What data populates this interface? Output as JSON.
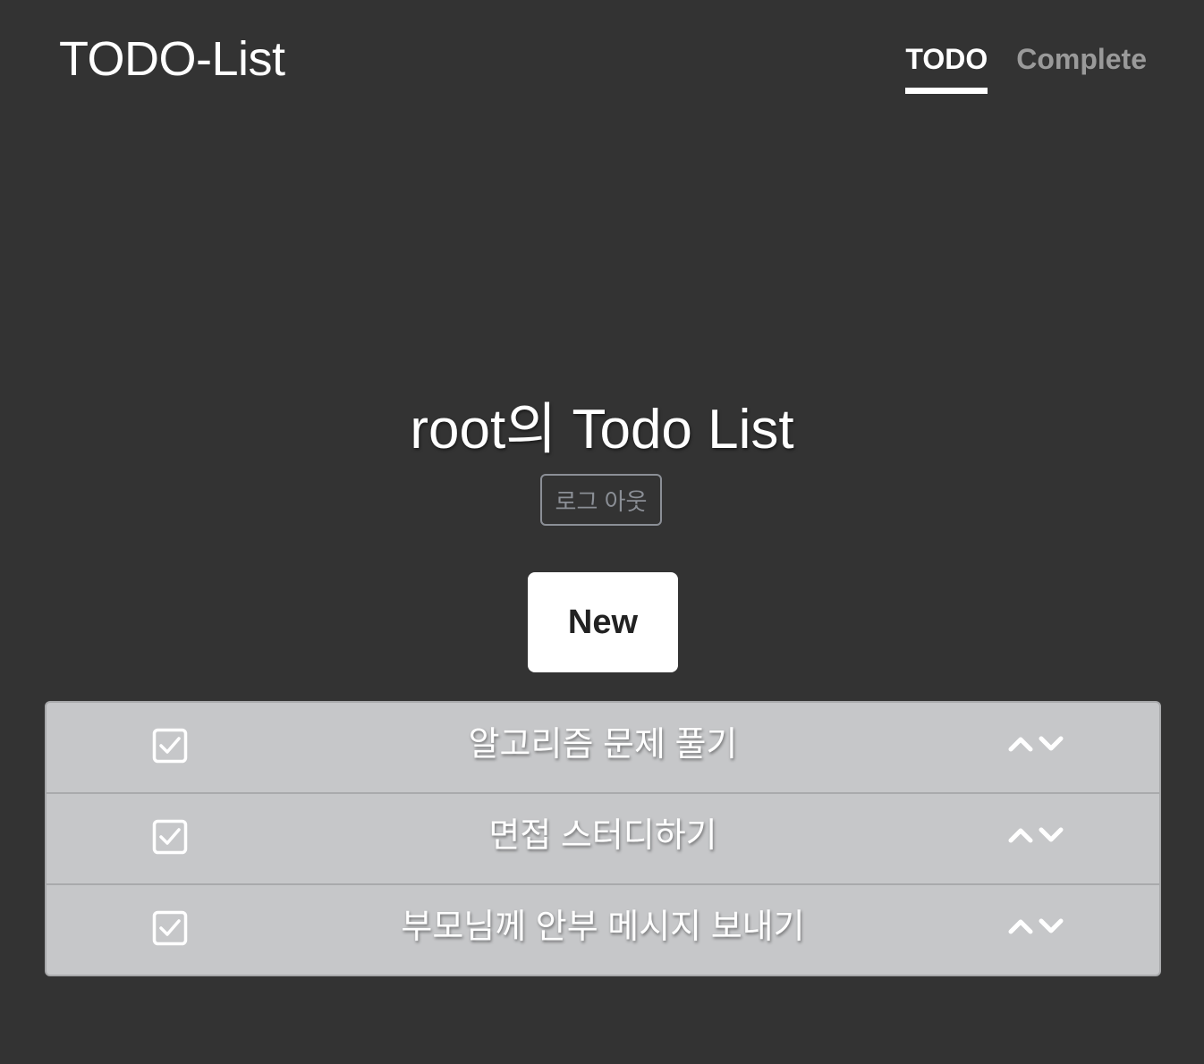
{
  "header": {
    "brand": "TODO-List",
    "tabs": [
      {
        "label": "TODO",
        "active": true
      },
      {
        "label": "Complete",
        "active": false
      }
    ]
  },
  "main": {
    "title": "root의 Todo List",
    "logout_label": "로그 아웃",
    "new_label": "New"
  },
  "todos": [
    {
      "text": "알고리즘 문제 풀기",
      "checked": true
    },
    {
      "text": "면접 스터디하기",
      "checked": true
    },
    {
      "text": "부모님께 안부 메시지 보내기",
      "checked": true
    }
  ],
  "icons": {
    "checkbox": "checkbox-checked-icon",
    "up": "chevron-up-icon",
    "down": "chevron-down-icon"
  },
  "colors": {
    "background": "#333333",
    "list_background": "#c6c7c9",
    "active_tab": "#ffffff",
    "inactive_tab": "#9a9a9a"
  }
}
